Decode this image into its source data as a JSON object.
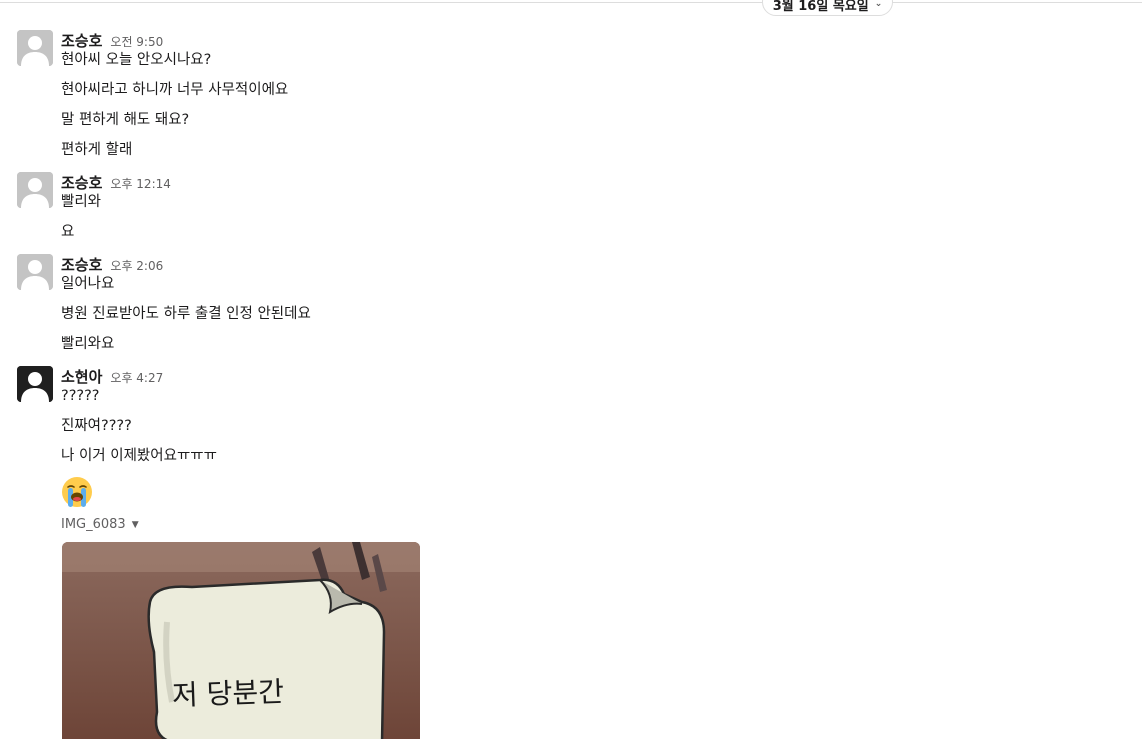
{
  "date_divider": {
    "label": "3월 16일 목요일"
  },
  "messages": [
    {
      "sender": "조승호",
      "time": "오전 9:50",
      "lines": [
        "현아씨 오늘 안오시나요?",
        "현아씨라고 하니까 너무 사무적이에요",
        "말 편하게 해도 돼요?",
        "편하게 할래"
      ]
    },
    {
      "sender": "조승호",
      "time": "오후 12:14",
      "lines": [
        "빨리와",
        "요"
      ]
    },
    {
      "sender": "조승호",
      "time": "오후 2:06",
      "lines": [
        "일어나요",
        "병원 진료받아도 하루 출결 인정 안된데요",
        "빨리와요"
      ]
    },
    {
      "sender": "소현아",
      "time": "오후 4:27",
      "lines": [
        "?????",
        "진짜여????",
        "나 이거 이제봤어요ㅠㅠㅠ"
      ],
      "emoji": "loudly-crying-face",
      "attachment": {
        "filename": "IMG_6083",
        "image_text": "저 당분간"
      }
    }
  ]
}
